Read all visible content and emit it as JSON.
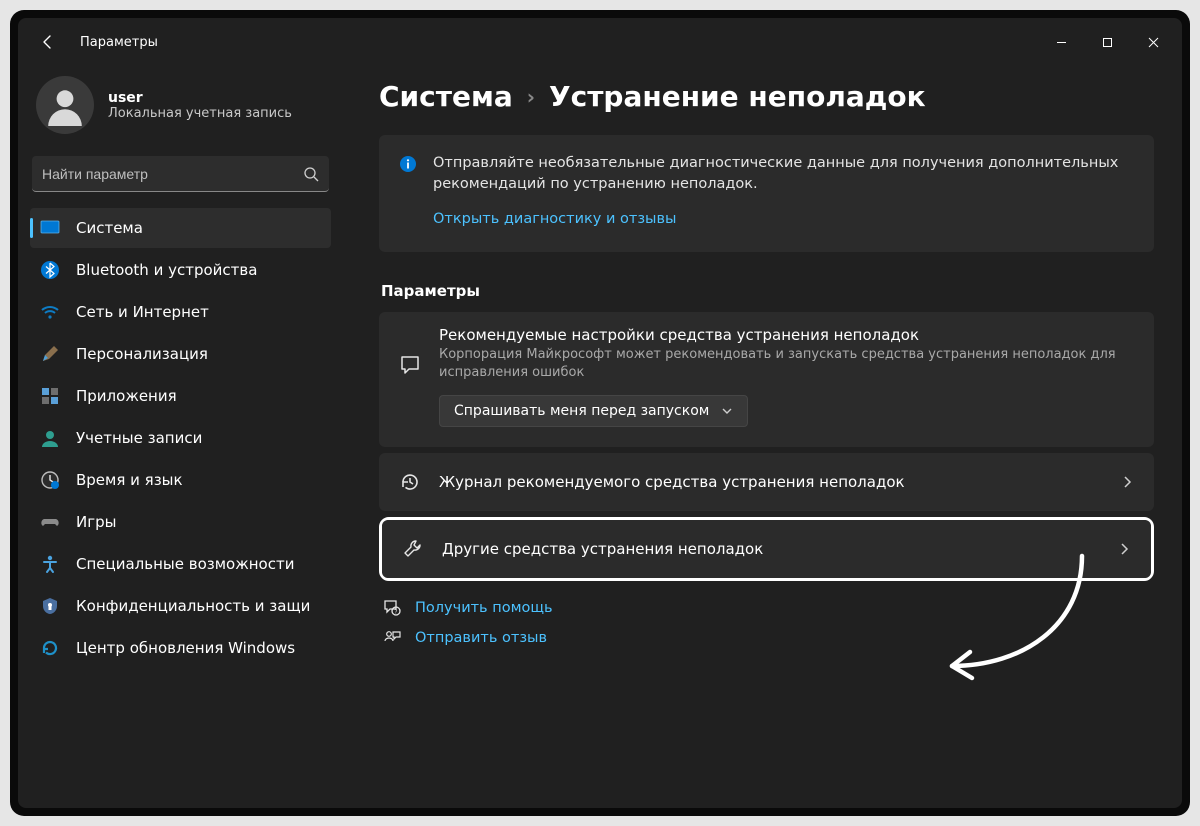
{
  "app": {
    "title": "Параметры"
  },
  "user": {
    "name": "user",
    "type": "Локальная учетная запись"
  },
  "search": {
    "placeholder": "Найти параметр"
  },
  "nav": {
    "items": [
      {
        "id": "system",
        "label": "Система",
        "selected": true
      },
      {
        "id": "bluetooth",
        "label": "Bluetooth и устройства",
        "selected": false
      },
      {
        "id": "network",
        "label": "Сеть и Интернет",
        "selected": false
      },
      {
        "id": "personalization",
        "label": "Персонализация",
        "selected": false
      },
      {
        "id": "apps",
        "label": "Приложения",
        "selected": false
      },
      {
        "id": "accounts",
        "label": "Учетные записи",
        "selected": false
      },
      {
        "id": "timelang",
        "label": "Время и язык",
        "selected": false
      },
      {
        "id": "gaming",
        "label": "Игры",
        "selected": false
      },
      {
        "id": "accessibility",
        "label": "Специальные возможности",
        "selected": false
      },
      {
        "id": "privacy",
        "label": "Конфиденциальность и защи",
        "selected": false
      },
      {
        "id": "update",
        "label": "Центр обновления Windows",
        "selected": false
      }
    ]
  },
  "breadcrumb": {
    "parent": "Система",
    "current": "Устранение неполадок"
  },
  "info": {
    "text": "Отправляйте необязательные диагностические данные для получения дополнительных рекомендаций по устранению неполадок.",
    "link": "Открыть диагностику и отзывы"
  },
  "section": {
    "title": "Параметры"
  },
  "recommended": {
    "title": "Рекомендуемые настройки средства устранения неполадок",
    "desc": "Корпорация Майкрософт может рекомендовать и запускать средства устранения неполадок для исправления ошибок",
    "dropdown_value": "Спрашивать меня перед запуском"
  },
  "rows": {
    "history": "Журнал рекомендуемого средства устранения неполадок",
    "other": "Другие средства устранения неполадок"
  },
  "help": {
    "get_help": "Получить помощь",
    "feedback": "Отправить отзыв"
  }
}
